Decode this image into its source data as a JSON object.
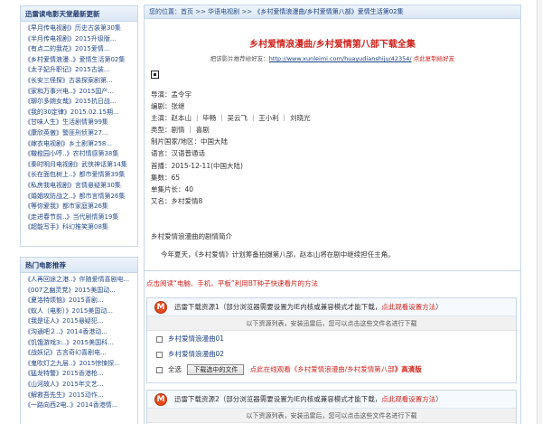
{
  "sidebar": {
    "box1": {
      "title": "迅雷读电影天堂最新更新",
      "items": [
        {
          "left": "《早月传电视剧》",
          "right": "历史古装第30集"
        },
        {
          "left": "《半月传电视剧》",
          "right": "2015升级版..."
        },
        {
          "left": "《有点二的我花》",
          "right": "2015爱情..."
        },
        {
          "left": "《乡村爱情浪漫..》",
          "right": "爱情生活第02集"
        },
        {
          "left": "《太子妃升职记》",
          "right": "2015古装..."
        },
        {
          "left": "《长安三怪探》",
          "right": "古装探案剧第..."
        },
        {
          "left": "《家和万事兴电..》",
          "right": "2015国产..."
        },
        {
          "left": "《聊尔多婉女哉》",
          "right": "2015抗日战..."
        },
        {
          "left": "《我的30定律》",
          "right": "2015.02.15期..."
        },
        {
          "left": "《甘味人生》",
          "right": "生活剧情第99集"
        },
        {
          "left": "《康欣英傲》",
          "right": "警匪刑侦第27..."
        },
        {
          "left": "《嫁衣电视剧》",
          "right": "乡土剧第258..."
        },
        {
          "left": "《橄榄园小哼..》",
          "right": "农村情感第38集"
        },
        {
          "left": "《秦时明月电视剧》",
          "right": "武侠神话第14集"
        },
        {
          "left": "《长在面包树上..》",
          "right": "都市爱情第39集"
        },
        {
          "left": "《私房我电视剧》",
          "right": "言情悬疑第30集"
        },
        {
          "left": "《婚姻攻防战之..》",
          "right": "都市言情第26集"
        },
        {
          "left": "《等你爱我》",
          "right": "都市家庭第26集"
        },
        {
          "left": "《走进春节前..》",
          "right": "当代剧情第19集"
        },
        {
          "left": "《超能写手》",
          "right": "科幻推笑第08集"
        }
      ]
    },
    "box2": {
      "title": "热门电影推荐",
      "items": [
        {
          "left": "《人再回途之港..》",
          "right": "伴随爱情喜剧电..."
        },
        {
          "left": "《007之幽灵党》",
          "right": "2015美国动..."
        },
        {
          "left": "《夏洛特烦恼》",
          "right": "2015喜剧..."
        },
        {
          "left": "《蚁人（电影）》",
          "right": "2015美国动..."
        },
        {
          "left": "《我是证人》",
          "right": "2015悬疑犯..."
        },
        {
          "left": "《沟通吧２..》",
          "right": "2014香港动..."
        },
        {
          "left": "《饥饿游戏3:..》",
          "right": "2015美国科..."
        },
        {
          "left": "《战妖记》",
          "right": "古言奇幻喜剧电..."
        },
        {
          "left": "《鬼吹灯之九层..》",
          "right": "2015惊悚探..."
        },
        {
          "left": "《猛龙特警》",
          "right": "2015香港枪..."
        },
        {
          "left": "《山河故人》",
          "right": "2015年文艺..."
        },
        {
          "left": "《解救吾先生》",
          "right": "2015动作..."
        },
        {
          "left": "《一路向西2电..》",
          "right": "2014香港情..."
        }
      ]
    }
  },
  "breadcrumb": {
    "prefix": "您的位置：首页 >> 华语电视剧 >> ",
    "current": "《乡村爱情浪漫曲/乡村爱情第八部》爱情生活第02集"
  },
  "title": "乡村爱情浪漫曲/乡村爱情第八部下载全集",
  "share": {
    "label": "把该影片推荐给好友：",
    "url": "http://www.xunleimi.com/huayudianshiju/42354/",
    "action": "点此复制给好友"
  },
  "info": {
    "director": "导演：孟令宇",
    "writer": "编剧：张继",
    "cast": "主演：赵本山 ｜ 毕畅 ｜ 吴云飞 ｜ 王小利 ｜ 刘晓光",
    "genre": "类型：剧情 ｜ 喜剧",
    "region": "制片国家/地区：中国大陆",
    "language": "语言：汉语普通话",
    "premiere": "首播：2015-12-11(中国大陆)",
    "episodes": "集数：65",
    "episode_length": "单集片长：40",
    "alias": "又名：乡村爱情8"
  },
  "synopsis": {
    "heading": "乡村爱情浪漫曲的剧情简介",
    "text": "今年夏天，《乡村爱情》计划筹备拍摄第八部，赵本山将在剧中继续担任主角。"
  },
  "tip": "点击阅读“电脑、手机、平板”利用BT种子快速看片的方法",
  "downloads": {
    "source1": {
      "label": "迅雷下载资源1（部分浏览器需要设置为IE内核或兼容模式才能下载，",
      "link": "点此观看设置方法",
      "close": "）",
      "note": "以下资源列表，安装迅雷后，您可以点击这些文件名进行下载",
      "files": [
        "乡村爱情浪漫曲01",
        "乡村爱情浪漫曲02"
      ],
      "select_all": "全选",
      "button": "下载选中的文件",
      "online_prefix": "点此在线观看《",
      "online_name": "乡村爱情浪漫曲/乡村爱情第八部",
      "online_suffix": "》高清版"
    },
    "source2": {
      "label": "迅雷下载资源2（部分浏览器需要设置为IE内核或兼容模式才能下载，",
      "link": "点此观看设置方法",
      "close": "）",
      "note": "以下资源列表，安装迅雷后，您可以点击这些文件名进行下载"
    }
  },
  "icons": {
    "thunder": "thunder-m-icon",
    "qr": "qr-icon"
  },
  "colors": {
    "accent_red": "#d0241e",
    "link_blue": "#1a3f86",
    "border": "#c6d6ea"
  }
}
